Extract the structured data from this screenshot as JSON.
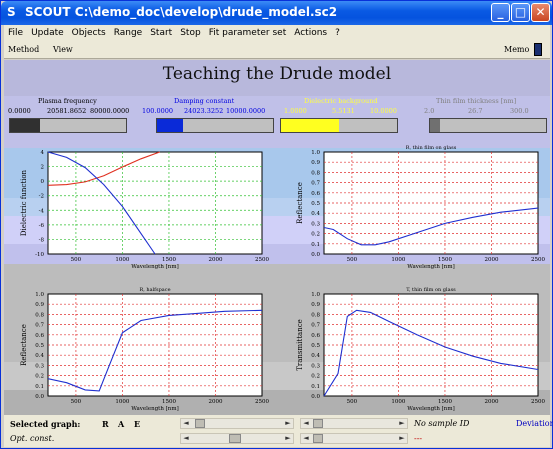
{
  "window": {
    "app": "SCOUT",
    "path": "C:\\demo_doc\\develop\\drude_model.sc2"
  },
  "menu": [
    "File",
    "Update",
    "Objects",
    "Range",
    "Start",
    "Stop",
    "Fit parameter set",
    "Actions",
    "?"
  ],
  "toolbar": {
    "method": "Method",
    "view": "View",
    "memo": "Memo"
  },
  "heading": "Teaching the Drude model",
  "sliders": [
    {
      "label": "Plasma frequency",
      "min": "0.0000",
      "value": "20581.8652",
      "max": "80000.0000",
      "fill": 0.26,
      "color": "#000000",
      "fill_color": "#303030"
    },
    {
      "label": "Damping constant",
      "min": "100.0000",
      "value": "24023.3252",
      "max": "10000.0000",
      "fill": 0.22,
      "color": "#0000e0",
      "fill_color": "#0a2ad8"
    },
    {
      "label": "Dielectric background",
      "min": "1.0000",
      "value": "5.5131",
      "max": "10.0000",
      "fill": 0.5,
      "color": "#ffff40",
      "fill_color": "#ffff20"
    },
    {
      "label": "Thin film thickness [nm]",
      "min": "2.0",
      "value": "26.7",
      "max": "300.0",
      "fill": 0.09,
      "color": "#808080",
      "fill_color": "#707070"
    }
  ],
  "charts": [
    {
      "title": "",
      "ylabel": "Dielectric function",
      "xlabel": "Wavelength [nm]",
      "xticks": [
        "500",
        "1000",
        "1500",
        "2000",
        "2500"
      ],
      "yticks": [
        "4",
        "2",
        "0",
        "-2",
        "-4",
        "-6",
        "-8",
        "-10"
      ]
    },
    {
      "title": "R, thin film on glass",
      "ylabel": "Reflectance",
      "xlabel": "Wavelength [nm]",
      "xticks": [
        "500",
        "1000",
        "1500",
        "2000",
        "2500"
      ],
      "yticks": [
        "1.0",
        "0.9",
        "0.8",
        "0.7",
        "0.6",
        "0.5",
        "0.4",
        "0.3",
        "0.2",
        "0.1",
        "0.0"
      ]
    },
    {
      "title": "R, halfspace",
      "ylabel": "Reflectance",
      "xlabel": "Wavelength [nm]",
      "xticks": [
        "500",
        "1000",
        "1500",
        "2000",
        "2500"
      ],
      "yticks": [
        "1.0",
        "0.9",
        "0.8",
        "0.7",
        "0.6",
        "0.5",
        "0.4",
        "0.3",
        "0.2",
        "0.1",
        "0.0"
      ]
    },
    {
      "title": "T, thin film on glass",
      "ylabel": "Transmittance",
      "xlabel": "Wavelength [nm]",
      "xticks": [
        "500",
        "1000",
        "1500",
        "2000",
        "2500"
      ],
      "yticks": [
        "1.0",
        "0.9",
        "0.8",
        "0.7",
        "0.6",
        "0.5",
        "0.4",
        "0.3",
        "0.2",
        "0.1",
        "0.0"
      ]
    }
  ],
  "chart_data": [
    {
      "type": "line",
      "title": "",
      "xlabel": "Wavelength [nm]",
      "ylabel": "Dielectric function",
      "xlim": [
        200,
        2500
      ],
      "ylim": [
        -10,
        5
      ],
      "grid": true,
      "series": [
        {
          "color": "#e03020",
          "x": [
            200,
            400,
            600,
            800,
            1000,
            1200,
            1400
          ],
          "y": [
            0.1,
            0.2,
            0.6,
            1.5,
            2.8,
            4.0,
            5.0
          ]
        },
        {
          "color": "#2030d0",
          "x": [
            200,
            400,
            600,
            800,
            1000,
            1200,
            1350
          ],
          "y": [
            5.0,
            4.2,
            2.7,
            0.2,
            -3.0,
            -7.0,
            -10.0
          ]
        }
      ]
    },
    {
      "type": "line",
      "title": "R, thin film on glass",
      "xlabel": "Wavelength [nm]",
      "ylabel": "Reflectance",
      "xlim": [
        200,
        2500
      ],
      "ylim": [
        0,
        1
      ],
      "grid": true,
      "series": [
        {
          "color": "#2030d0",
          "x": [
            200,
            300,
            450,
            600,
            750,
            900,
            1200,
            1500,
            1800,
            2100,
            2500
          ],
          "y": [
            0.26,
            0.24,
            0.15,
            0.09,
            0.09,
            0.12,
            0.21,
            0.3,
            0.36,
            0.41,
            0.45
          ]
        }
      ]
    },
    {
      "type": "line",
      "title": "R, halfspace",
      "xlabel": "Wavelength [nm]",
      "ylabel": "Reflectance",
      "xlim": [
        200,
        2500
      ],
      "ylim": [
        0,
        1
      ],
      "grid": true,
      "series": [
        {
          "color": "#2030d0",
          "x": [
            200,
            400,
            600,
            750,
            850,
            1000,
            1200,
            1500,
            1800,
            2100,
            2500
          ],
          "y": [
            0.17,
            0.13,
            0.06,
            0.05,
            0.28,
            0.62,
            0.74,
            0.79,
            0.81,
            0.83,
            0.84
          ]
        }
      ]
    },
    {
      "type": "line",
      "title": "T, thin film on glass",
      "xlabel": "Wavelength [nm]",
      "ylabel": "Transmittance",
      "xlim": [
        200,
        2500
      ],
      "ylim": [
        0,
        1
      ],
      "grid": true,
      "series": [
        {
          "color": "#2030d0",
          "x": [
            200,
            350,
            450,
            550,
            700,
            900,
            1200,
            1500,
            1800,
            2100,
            2500
          ],
          "y": [
            0.0,
            0.22,
            0.78,
            0.84,
            0.82,
            0.73,
            0.6,
            0.48,
            0.39,
            0.32,
            0.26
          ]
        }
      ]
    }
  ],
  "status": {
    "selected_graph": "Selected graph:",
    "modes": [
      "R",
      "A",
      "E"
    ],
    "opt_const": "Opt. const.",
    "sample": "No sample ID",
    "dashes": "---",
    "deviation": "Deviation"
  }
}
